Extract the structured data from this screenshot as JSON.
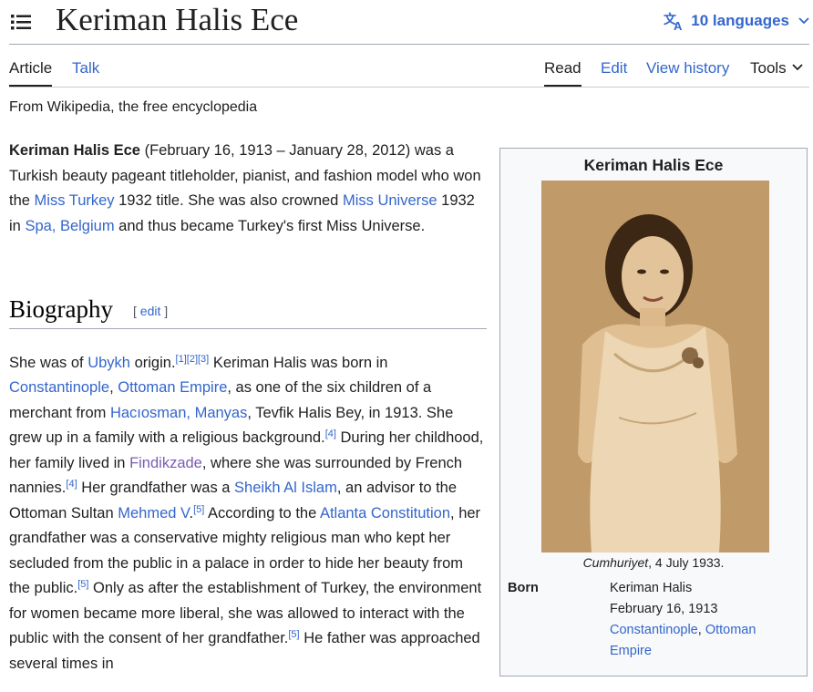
{
  "header": {
    "title": "Keriman Halis Ece",
    "languages_label": "10 languages"
  },
  "tabs": {
    "article": "Article",
    "talk": "Talk",
    "read": "Read",
    "edit": "Edit",
    "view_history": "View history",
    "tools": "Tools"
  },
  "tagline": "From Wikipedia, the free encyclopedia",
  "lead": {
    "name": "Keriman Halis Ece",
    "t1": " (February 16, 1913 – January 28, 2012) was a Turkish beauty pageant titleholder, pianist, and fashion model who won the ",
    "l1": "Miss Turkey",
    "t2": " 1932 title. She was also crowned ",
    "l2": "Miss Universe",
    "t3": " 1932 in ",
    "l3": "Spa, Belgium",
    "t4": " and thus became Turkey's first Miss Universe."
  },
  "biography": {
    "heading": "Biography",
    "edit_open": "[ ",
    "edit_label": "edit",
    "edit_close": " ]",
    "s1": "She was of ",
    "ubykh": "Ubykh",
    "s2": " origin.",
    "r1": "[1]",
    "r2": "[2]",
    "r3": "[3]",
    "s3": " Keriman Halis was born in ",
    "constantinople": "Constantinople",
    "comma1": ", ",
    "ottoman": "Ottoman Empire",
    "s4": ", as one of the six children of a merchant from ",
    "haciosman": "Hacıosman, Manyas",
    "s5": ", Tevfik Halis Bey, in 1913. She grew up in a family with a religious background.",
    "r4a": "[4]",
    "s6": " During her childhood, her family lived in ",
    "findikzade": "Findikzade",
    "s7": ", where she was surrounded by French nannies.",
    "r4b": "[4]",
    "s8": " Her grandfather was a ",
    "sheikh": "Sheikh Al Islam",
    "s9": ", an advisor to the Ottoman Sultan ",
    "mehmed": "Mehmed V",
    "dot1": ".",
    "r5a": "[5]",
    "s10": " According to the ",
    "atlanta": "Atlanta Constitution",
    "s11": ", her grandfather was a conservative mighty religious man who kept her secluded from the public in a palace in order to hide her beauty from the public.",
    "r5b": "[5]",
    "s12": " Only as after the establishment of Turkey, the environment for women became more liberal, she was allowed to interact with the public with the consent of her grandfather.",
    "r5c": "[5]",
    "s13": " He father was approached several times in"
  },
  "infobox": {
    "title": "Keriman Halis Ece",
    "caption_italic": "Cumhuriyet",
    "caption_rest": ", 4 July 1933.",
    "born_label": "Born",
    "born_name": "Keriman Halis",
    "born_date": "February 16, 1913",
    "born_place1": "Constantinople",
    "born_sep": ", ",
    "born_place2": "Ottoman Empire"
  },
  "colors": {
    "link": "#3366cc",
    "visited_link": "#795cb2",
    "text": "#202122",
    "photo_sepia": "#c19a66"
  },
  "icons": [
    "menu-icon",
    "translate-icon",
    "chevron-down-icon"
  ]
}
